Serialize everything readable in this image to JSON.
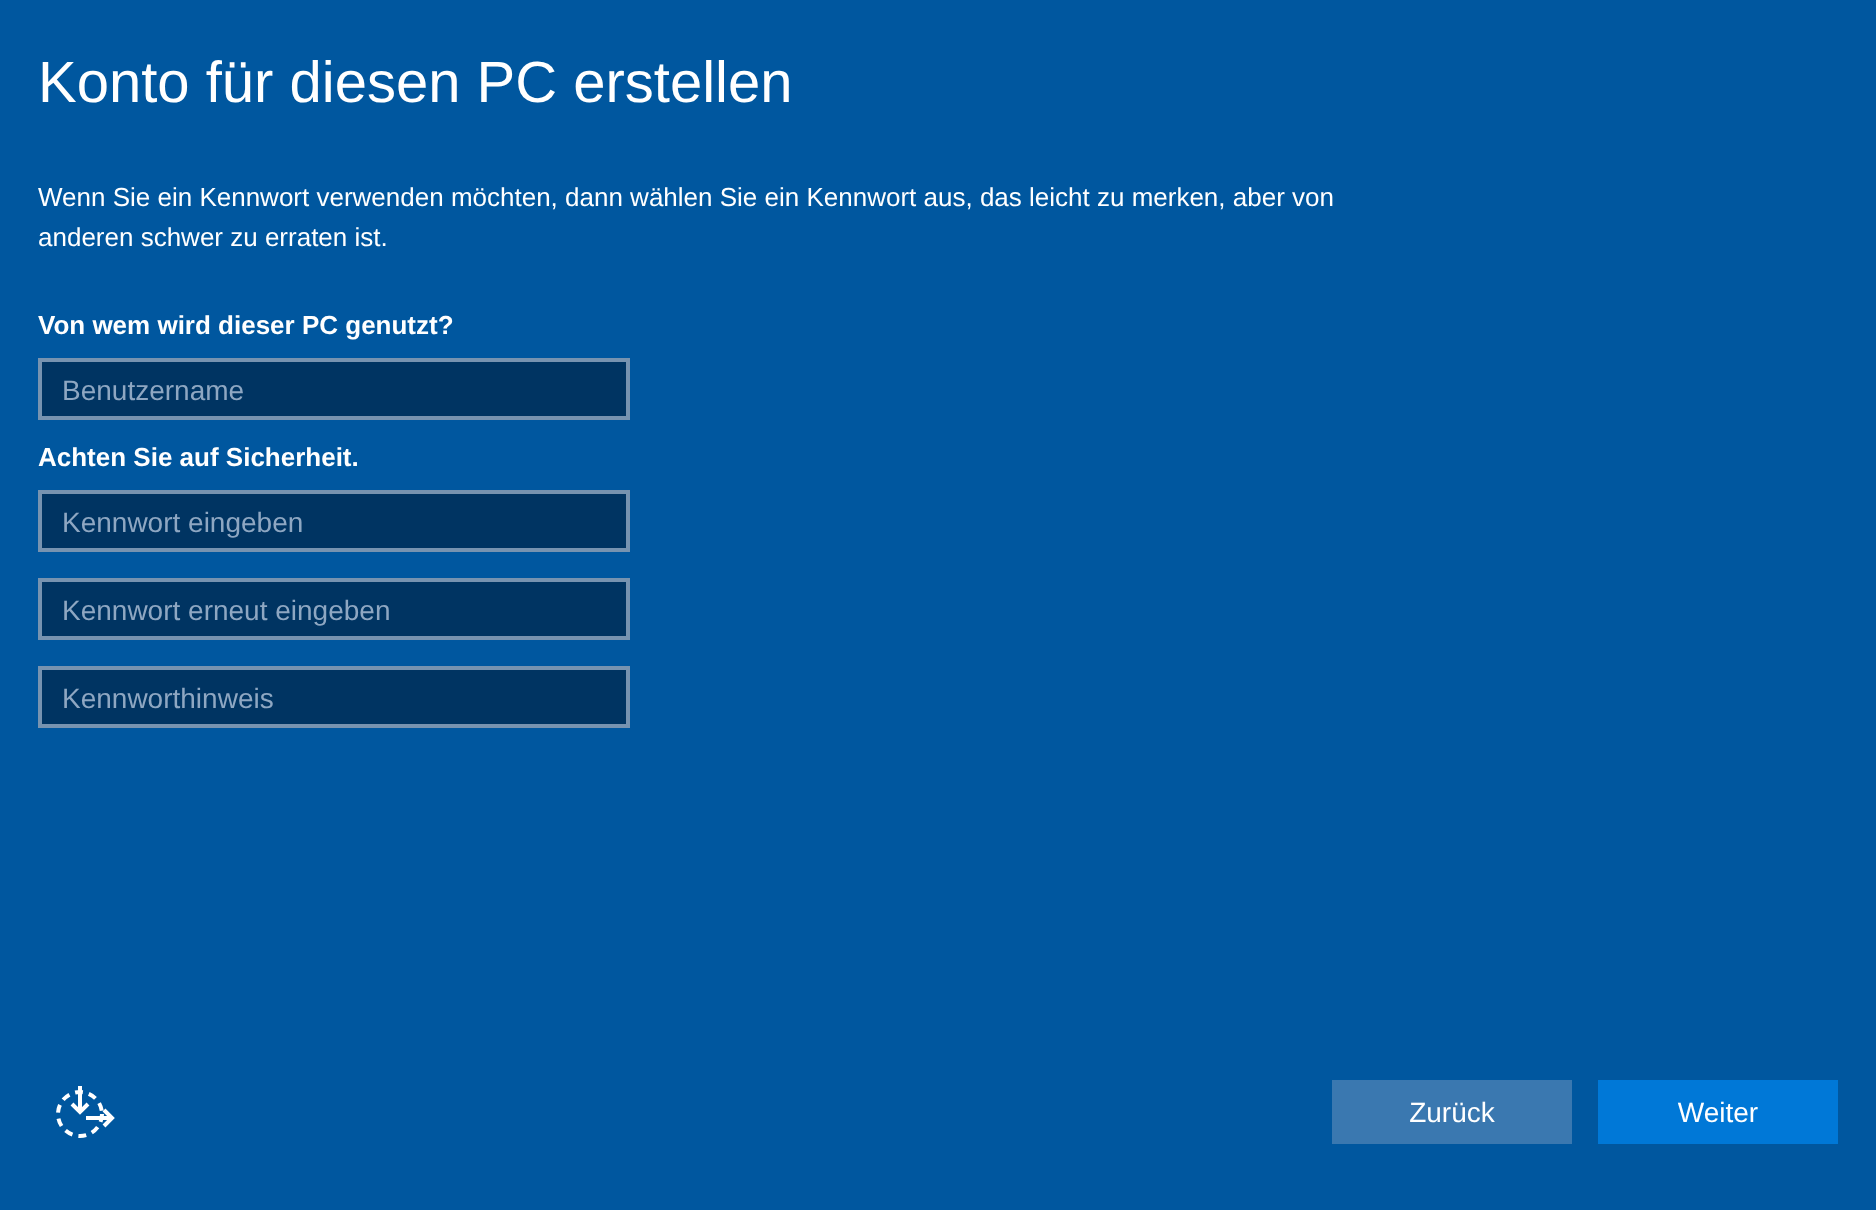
{
  "title": "Konto für diesen PC erstellen",
  "intro": "Wenn Sie ein Kennwort verwenden möchten, dann wählen Sie ein Kennwort aus, das leicht zu merken, aber von anderen schwer zu erraten ist.",
  "sections": [
    {
      "heading": "Von wem wird dieser PC genutzt?",
      "fields": [
        {
          "placeholder": "Benutzername"
        }
      ]
    },
    {
      "heading": "Achten Sie auf Sicherheit.",
      "fields": [
        {
          "placeholder": "Kennwort eingeben"
        },
        {
          "placeholder": "Kennwort erneut eingeben"
        },
        {
          "placeholder": "Kennworthinweis"
        }
      ]
    }
  ],
  "buttons": [
    {
      "label": "Zurück",
      "kind": "secondary"
    },
    {
      "label": "Weiter",
      "kind": "primary"
    }
  ]
}
